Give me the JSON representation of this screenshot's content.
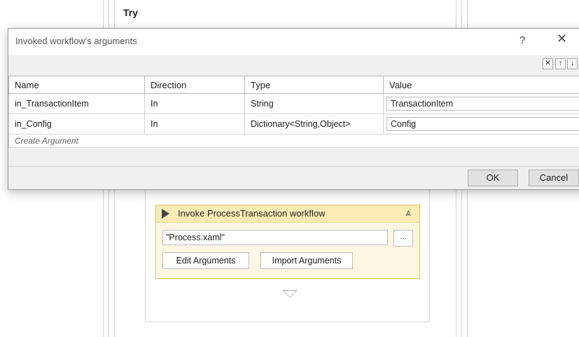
{
  "designer": {
    "try_label": "Try",
    "invoke": {
      "title": "Invoke ProcessTransaction workflow",
      "workflow_path": "\"Process.xaml\"",
      "browse_label": "...",
      "edit_arguments_label": "Edit Arguments",
      "import_arguments_label": "Import Arguments"
    }
  },
  "dialog": {
    "title": "Invoked workflow's arguments",
    "help_label": "?",
    "close_label": "✕",
    "toolbar": {
      "delete_label": "✕",
      "up_label": "↑",
      "down_label": "↓"
    },
    "columns": [
      "Name",
      "Direction",
      "Type",
      "Value"
    ],
    "rows": [
      {
        "name": "in_TransactionItem",
        "direction": "In",
        "type": "String",
        "value": "TransactionItem"
      },
      {
        "name": "in_Config",
        "direction": "In",
        "type": "Dictionary<String,Object>",
        "value": "Config"
      }
    ],
    "create_argument_label": "Create Argument",
    "ok_label": "OK",
    "cancel_label": "Cancel"
  }
}
